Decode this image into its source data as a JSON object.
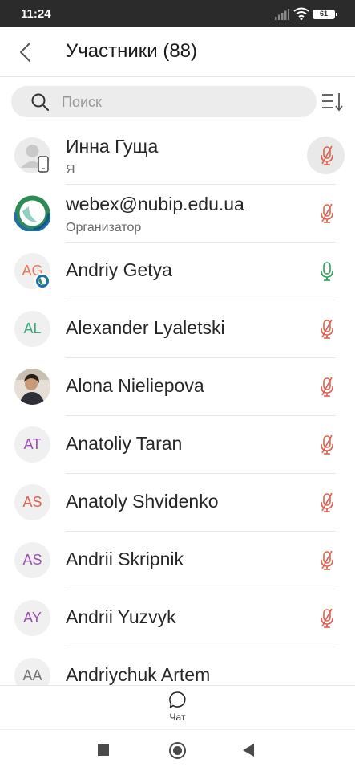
{
  "status_bar": {
    "time": "11:24",
    "battery": "61"
  },
  "header": {
    "title": "Участники (88)"
  },
  "search": {
    "placeholder": "Поиск"
  },
  "participants": [
    {
      "name": "Инна Гуща",
      "subtitle": "Я",
      "avatar_type": "placeholder-mobile",
      "mic": "muted",
      "mic_active": true
    },
    {
      "name": "webex@nubip.edu.ua",
      "subtitle": "Организатор",
      "avatar_type": "webex-logo",
      "mic": "muted"
    },
    {
      "name": "Andriy Getya",
      "initials": "AG",
      "initials_color": "#e8775a",
      "avatar_type": "initials-webex",
      "mic": "unmuted"
    },
    {
      "name": "Alexander Lyaletski",
      "initials": "AL",
      "initials_color": "#3aa57a",
      "avatar_type": "initials",
      "mic": "muted"
    },
    {
      "name": "Alona Nieliepova",
      "avatar_type": "photo",
      "mic": "muted"
    },
    {
      "name": "Anatoliy Taran",
      "initials": "AT",
      "initials_color": "#9b4fb5",
      "avatar_type": "initials",
      "mic": "muted"
    },
    {
      "name": "Anatoly Shvidenko",
      "initials": "AS",
      "initials_color": "#e0604e",
      "avatar_type": "initials",
      "mic": "muted"
    },
    {
      "name": "Andrii Skripnik",
      "initials": "AS",
      "initials_color": "#9b4fb5",
      "avatar_type": "initials",
      "mic": "muted"
    },
    {
      "name": "Andrii Yuzvyk",
      "initials": "AY",
      "initials_color": "#9b4fb5",
      "avatar_type": "initials",
      "mic": "muted"
    },
    {
      "name": "Andriychuk Artem",
      "initials": "AA",
      "initials_color": "#6f6f6f",
      "avatar_type": "initials",
      "mic": "none"
    }
  ],
  "bottom_tab": {
    "label": "Чат"
  },
  "colors": {
    "muted_mic": "#e0604e",
    "unmuted_mic": "#2e9e5a"
  }
}
